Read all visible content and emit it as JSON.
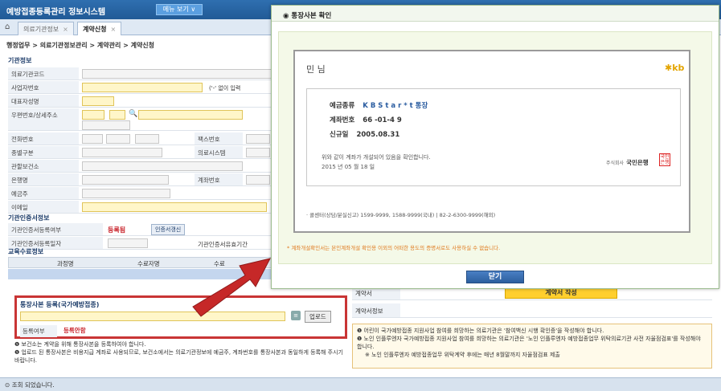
{
  "app": {
    "title": "예방접종등록관리 정보시스템",
    "menu_button": "메뉴 보기 ∨"
  },
  "tabs": [
    {
      "label": "의료기관정보"
    },
    {
      "label": "계약신청"
    }
  ],
  "breadcrumb": "행정업무 > 의료기관정보관리 > 계약관리 > 계약신청",
  "org_info": {
    "section": "기관정보",
    "fields": {
      "org_code": "의료기관코드",
      "biz_no": "사업자번호",
      "biz_no_hint": "('-' 없이 입력",
      "rep_name": "대표자성명",
      "address": "우편번호/상세주소",
      "phone": "전화번호",
      "fax": "팩스번호",
      "type": "종별구분",
      "system": "의료시스템",
      "health_center": "관할보건소",
      "bank": "은행명",
      "account": "계좌번호",
      "depositor": "예금주",
      "email": "이메일"
    }
  },
  "cert_info": {
    "section": "기관인증서정보",
    "cert_reg_label": "기관인증서등록여부",
    "cert_reg_value": "등록됨",
    "cert_renew_button": "인증서갱신",
    "cert_date_label": "기관인증서등록일자",
    "cert_expire_label": "기관인증서유효기간"
  },
  "edu_info": {
    "section": "교육수료정보",
    "columns": [
      "과정명",
      "수료자명",
      "수료"
    ]
  },
  "upload": {
    "title": "통장사본 등록(국가예방접종)",
    "button": "업로드",
    "reg_label": "등록여부",
    "reg_value": "등록안함"
  },
  "left_notes": [
    "보건소는 계약을 위해 통장사본을 등록하여야 합니다.",
    "업로드 된 통장사본은 비용지급 계좌로 사용되므로, 보건소에서는 의료기관정보에 예금주, 계좌번호를 통장사본과 동일하게 등록해 주시기 바랍니다."
  ],
  "right_rows": {
    "contract_label": "계약서",
    "contract_button": "계약서 작성",
    "contract_info_label": "계약서정보"
  },
  "right_notes": [
    "어린이 국가예방접종 지원사업 참여를 희망하는 의료기관은 '참여백신 시행 확인증'을 작성해야 합니다.",
    "노인 인플루엔자 국가예방접종 지원사업 참여를 희망하는 의료기관은 '노인 인플루엔자 예방접종업무 위탁의료기관 사전 자율점검표'를 작성해야 합니다.",
    "※ 노인 인플루엔자 예방접종업무 위탁계약 후에는 매년 8월말까지 자율점검표 제출"
  ],
  "status_bar": "조회 되었습니다.",
  "popup": {
    "title": "통장사본 확인",
    "customer": "민  님",
    "kb_logo": "✱kb",
    "deposit_type_label": "예금종류",
    "deposit_type_value": "K B  S t a r * t 통장",
    "account_label": "계좌번호",
    "account_value": "66     -01-4     9",
    "open_date_label": "신규일",
    "open_date_value": "2005.08.31",
    "confirm_text": "위와 같이 계좌가 개설되어 있음을 확인합니다.",
    "issue_date": "2015 년 05 월 18 일",
    "bank_prefix": "주식회사",
    "bank_name": "국민은행",
    "seal_text": "국민은행",
    "callcenter": "· 콜센터(상담/분실신고) 1599-9999, 1588-9999(국내) | 82-2-6300-9999(해외)",
    "warning": "* 계좌개설확인서는 본인계좌개설 확인용 이외의 어떠한 용도의 증명서로도 사용하실 수 없습니다.",
    "close_button": "닫기"
  },
  "colors": {
    "accent": "#2f6fb0",
    "highlight_border": "#c93535",
    "arrow": "#c62828",
    "popup_bg": "#f4f9e8"
  }
}
